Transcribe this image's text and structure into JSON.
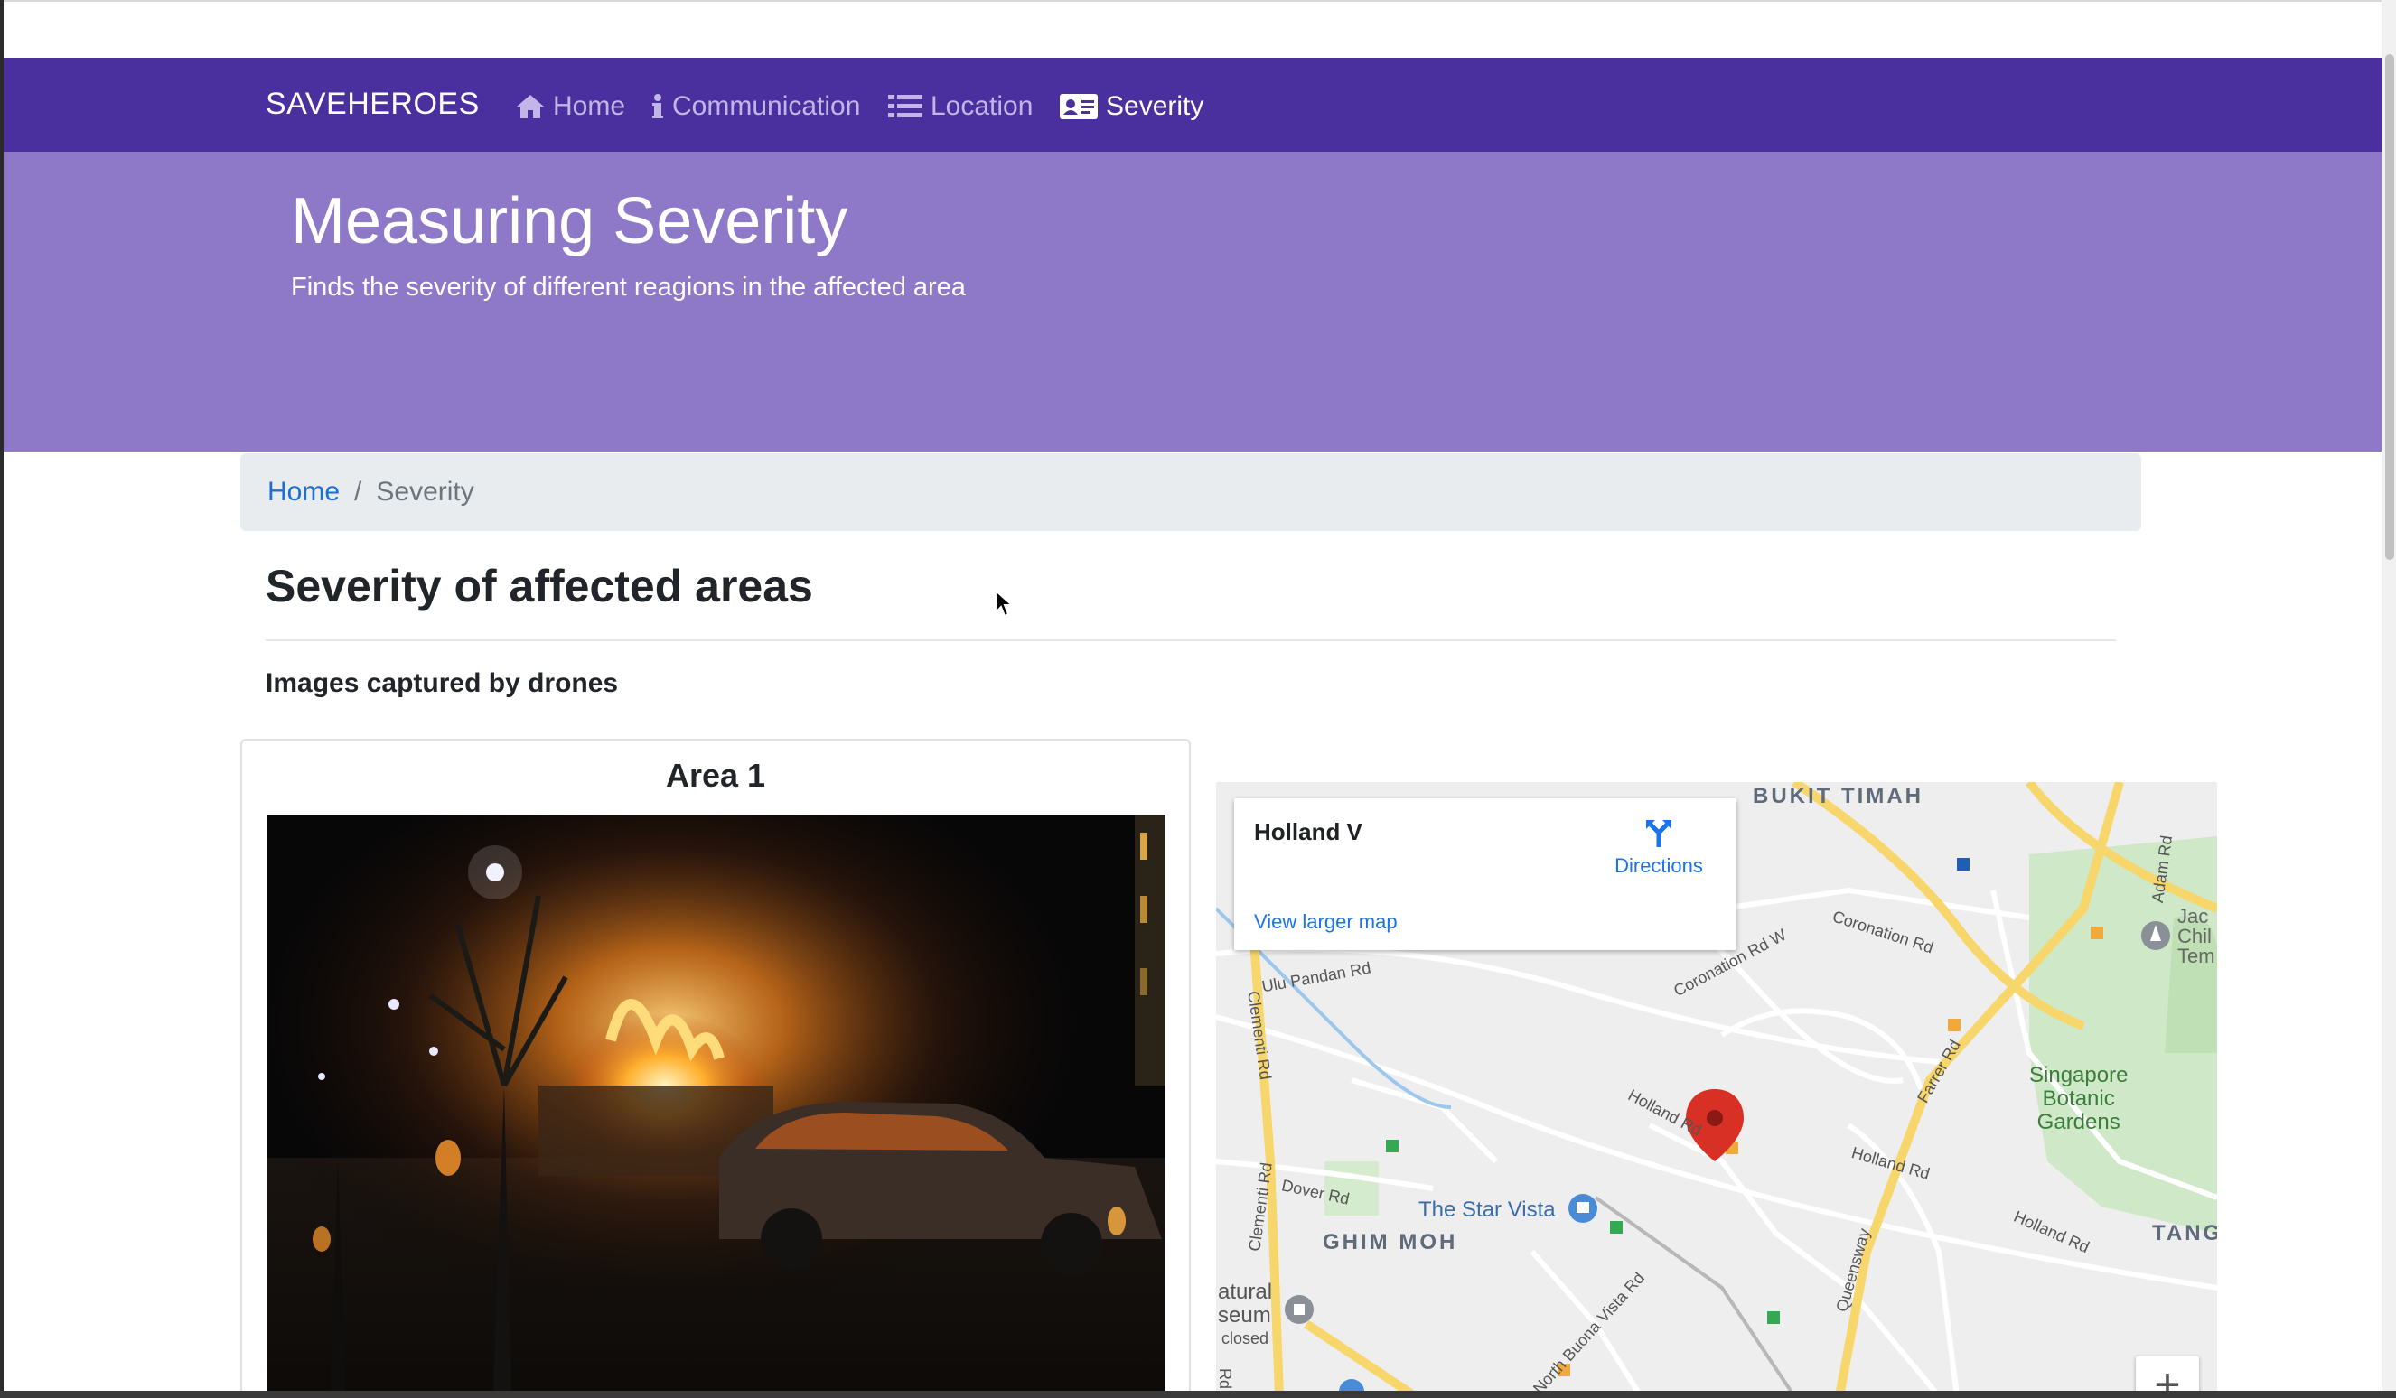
{
  "navbar": {
    "brand": "SAVEHEROES",
    "links": [
      {
        "label": "Home",
        "icon": "home-icon",
        "active": false
      },
      {
        "label": "Communication",
        "icon": "info-icon",
        "active": false
      },
      {
        "label": "Location",
        "icon": "list-icon",
        "active": false
      },
      {
        "label": "Severity",
        "icon": "id-card-icon",
        "active": true
      }
    ]
  },
  "jumbotron": {
    "title": "Measuring Severity",
    "subtitle": "Finds the severity of different reagions in the affected area"
  },
  "breadcrumb": {
    "home": "Home",
    "separator": "/",
    "current": "Severity"
  },
  "main": {
    "heading": "Severity of affected areas",
    "section_label": "Images captured by drones",
    "card": {
      "title": "Area 1",
      "image_icon": "burning-car-photo"
    }
  },
  "map": {
    "info": {
      "place": "Holland V",
      "directions": "Directions",
      "view_larger": "View larger map"
    },
    "labels": {
      "bukit_timah": "BUKIT TIMAH",
      "coronation_rd": "Coronation Rd",
      "coronation_rd_w": "Coronation Rd W",
      "ulu_pandan_rd": "Ulu Pandan Rd",
      "clementi_rd_1": "Clementi Rd",
      "clementi_rd_2": "Clementi Rd",
      "adam_rd": "Adam Rd",
      "farrer_rd": "Farrer Rd",
      "holland_rd_1": "Holland Rd",
      "holland_rd_2": "Holland Rd",
      "holland_rd_3": "Holland Rd",
      "botanic": "Singapore\nBotanic\nGardens",
      "tangli": "TANGLI",
      "queensway": "Queensway",
      "dover_rd": "Dover Rd",
      "star_vista": "The Star Vista",
      "ghim_moh": "GHIM MOH",
      "north_buona_vista": "North Buona Vista Rd",
      "museum": "atural\nseum",
      "closed": "closed",
      "jac_chil": "Jac\nChil\nTem",
      "rd_stub": "Rd"
    },
    "zoom_in": "+"
  },
  "colors": {
    "navbar": "#4a2f9f",
    "jumbotron": "#8e79c8",
    "link": "#1c6fd8",
    "map_road_major": "#f7d66b",
    "marker": "#d93025"
  }
}
